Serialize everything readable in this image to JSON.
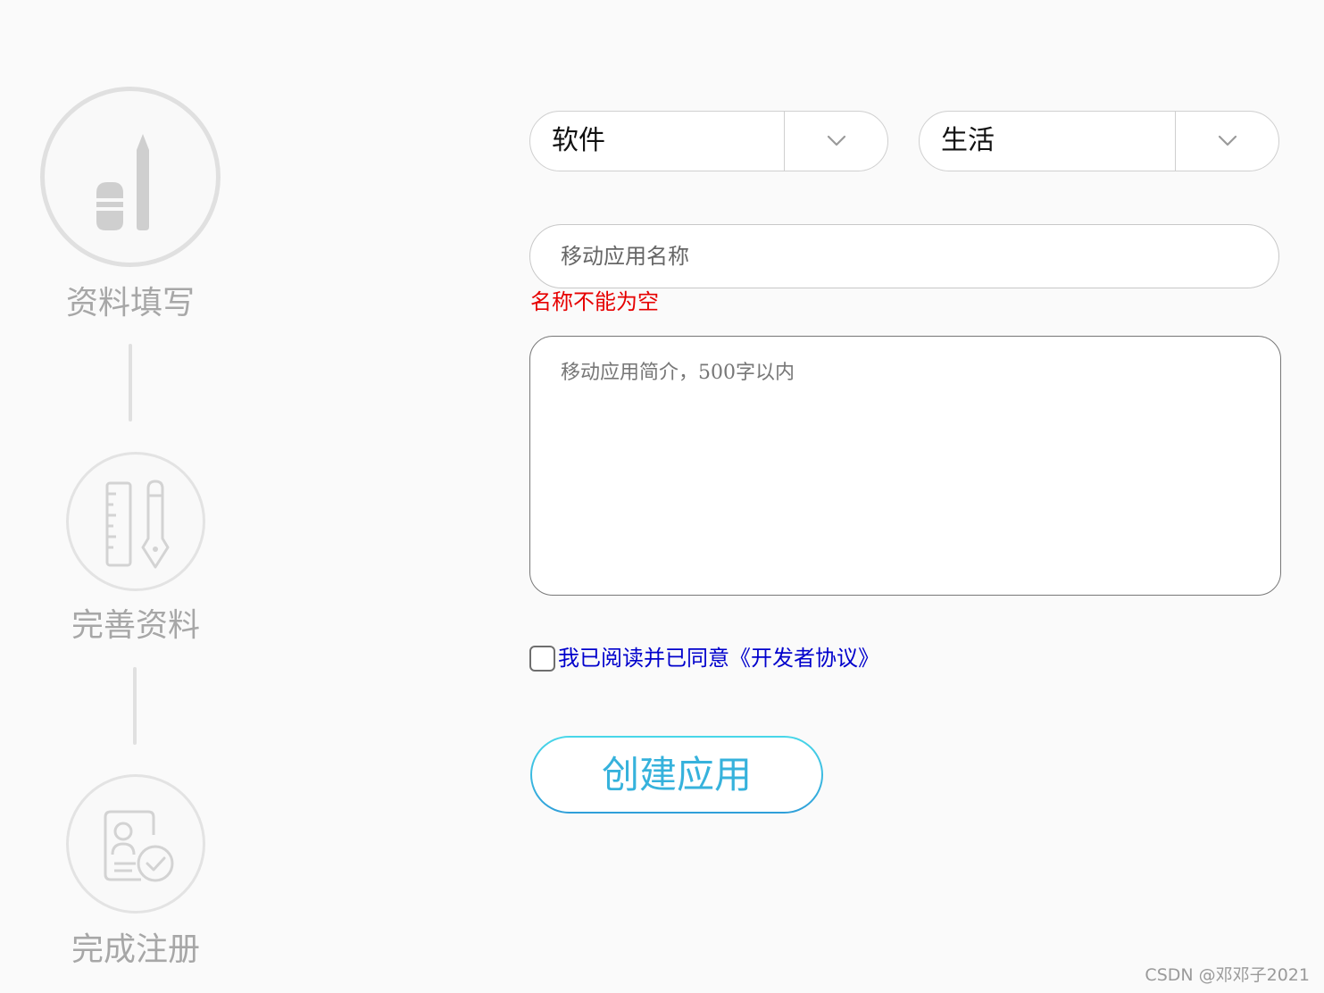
{
  "stepper": {
    "steps": [
      {
        "label": "资料填写",
        "icon": "pencil-eraser-icon",
        "status": "current"
      },
      {
        "label": "完善资料",
        "icon": "ruler-pen-icon",
        "status": "pending"
      },
      {
        "label": "完成注册",
        "icon": "profile-check-icon",
        "status": "pending"
      }
    ]
  },
  "form": {
    "category_select": {
      "value": "软件",
      "icon": "chevron-down-icon"
    },
    "subcategory_select": {
      "value": "生活",
      "icon": "chevron-down-icon"
    },
    "app_name": {
      "value": "",
      "placeholder": "移动应用名称"
    },
    "app_name_error": "名称不能为空",
    "app_description": {
      "value": "",
      "placeholder": "移动应用简介，500字以内"
    },
    "agreement": {
      "checked": false,
      "label": "我已阅读并已同意《开发者协议》"
    },
    "submit_label": "创建应用"
  },
  "watermark": "CSDN @邓邓子2021",
  "colors": {
    "background": "#fafafa",
    "step_gray": "#a7a7a7",
    "error": "#e60000",
    "link": "#0000cc",
    "accent": "#36b2dc"
  }
}
